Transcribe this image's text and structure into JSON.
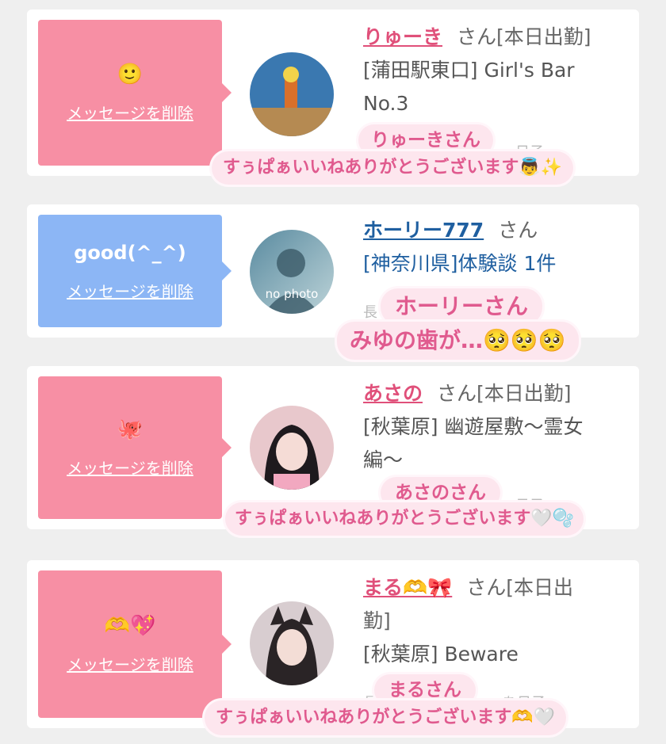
{
  "cards": [
    {
      "bubble_text": "🙂",
      "delete_label": "メッセージを削除",
      "name": "りゅーき",
      "san": "さん[本日出勤]",
      "area": "[蒲田駅東口] Girl's Bar",
      "area2": "No.3",
      "faded": "日子",
      "caption1": "りゅーきさん",
      "caption2": "すぅぱぁいいねありがとうございます👼✨"
    },
    {
      "bubble_text": "good(^_^)",
      "delete_label": "メッセージを削除",
      "name": "ホーリー777",
      "san": "さん",
      "area": "[神奈川県]体験談 1件",
      "faded": "長",
      "avatar_text": "no photo",
      "caption1": "ホーリーさん",
      "caption2": "みゆの歯が…🥺🥺🥺"
    },
    {
      "bubble_text": "🐙",
      "delete_label": "メッセージを削除",
      "name": "あさの",
      "san": "さん[本日出勤]",
      "area": "[秋葉原] 幽遊屋敷〜霊女",
      "area2": "編〜",
      "faded": "日子",
      "caption1": "あさのさん",
      "caption2": "すぅぱぁいいねありがとうございます🤍🫧"
    },
    {
      "bubble_text": "🫶💖",
      "delete_label": "メッセージを削除",
      "name": "まる🫶🎀",
      "san": "さん[本日出",
      "san2": "勤]",
      "area": "[秋葉原] Beware",
      "faded": "長",
      "faded2": "を日子",
      "caption1": "まるさん",
      "caption2": "すぅぱぁいいねありがとうございます🫶🤍"
    }
  ],
  "colors": {
    "pink_bubble": "#f78fa4",
    "blue_bubble": "#8cb6f5",
    "pink_name": "#e0507a",
    "blue_name": "#1f5fa0"
  }
}
